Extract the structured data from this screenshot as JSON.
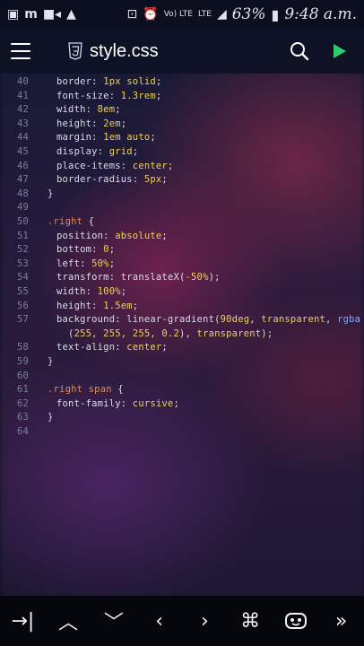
{
  "status_bar": {
    "icons_left": [
      "photos-icon",
      "m-app-icon",
      "video-icon",
      "warning-icon"
    ],
    "icons_right": [
      "cast-icon",
      "alarm-icon",
      "volte-icon",
      "lte-icon",
      "signal-icon"
    ],
    "volte_label": "Vo) LTE",
    "lte_label": "LTE",
    "battery_percent": "63%",
    "time": "9:48 a.m."
  },
  "toolbar": {
    "file_name": "style.css",
    "menu_icon": "hamburger-icon",
    "file_type_icon": "css3-icon",
    "search_icon": "search-icon",
    "run_icon": "play-icon",
    "accent_color": "#2ecc71"
  },
  "editor": {
    "lines": [
      {
        "n": "40",
        "parts": [
          [
            "prop",
            "border: "
          ],
          [
            "val",
            "1px solid"
          ],
          [
            "prop",
            ";"
          ]
        ]
      },
      {
        "n": "41",
        "parts": [
          [
            "prop",
            "font-size: "
          ],
          [
            "val",
            "1.3rem"
          ],
          [
            "prop",
            ";"
          ]
        ]
      },
      {
        "n": "42",
        "parts": [
          [
            "prop",
            "width: "
          ],
          [
            "val",
            "8em"
          ],
          [
            "prop",
            ";"
          ]
        ]
      },
      {
        "n": "43",
        "parts": [
          [
            "prop",
            "height: "
          ],
          [
            "val",
            "2em"
          ],
          [
            "prop",
            ";"
          ]
        ]
      },
      {
        "n": "44",
        "parts": [
          [
            "prop",
            "margin: "
          ],
          [
            "val",
            "1em auto"
          ],
          [
            "prop",
            ";"
          ]
        ]
      },
      {
        "n": "45",
        "parts": [
          [
            "prop",
            "display: "
          ],
          [
            "val",
            "grid"
          ],
          [
            "prop",
            ";"
          ]
        ]
      },
      {
        "n": "46",
        "parts": [
          [
            "prop",
            "place-items: "
          ],
          [
            "val",
            "center"
          ],
          [
            "prop",
            ";"
          ]
        ]
      },
      {
        "n": "47",
        "parts": [
          [
            "prop",
            "border-radius: "
          ],
          [
            "val",
            "5px"
          ],
          [
            "prop",
            ";"
          ]
        ]
      },
      {
        "n": "48",
        "parts": [
          [
            "brace",
            "}"
          ]
        ],
        "indent": 0
      },
      {
        "n": "49",
        "parts": []
      },
      {
        "n": "50",
        "parts": [
          [
            "sel",
            ".right "
          ],
          [
            "brace",
            "{"
          ]
        ],
        "indent": 0
      },
      {
        "n": "51",
        "parts": [
          [
            "prop",
            "position: "
          ],
          [
            "val",
            "absolute"
          ],
          [
            "prop",
            ";"
          ]
        ]
      },
      {
        "n": "52",
        "parts": [
          [
            "prop",
            "bottom: "
          ],
          [
            "val",
            "0"
          ],
          [
            "prop",
            ";"
          ]
        ]
      },
      {
        "n": "53",
        "parts": [
          [
            "prop",
            "left: "
          ],
          [
            "val",
            "50%"
          ],
          [
            "prop",
            ";"
          ]
        ]
      },
      {
        "n": "54",
        "parts": [
          [
            "prop",
            "transform: "
          ],
          [
            "fn",
            "translateX("
          ],
          [
            "val",
            "-50%"
          ],
          [
            "fn",
            ")"
          ],
          [
            "prop",
            ";"
          ]
        ]
      },
      {
        "n": "55",
        "parts": [
          [
            "prop",
            "width: "
          ],
          [
            "val",
            "100%"
          ],
          [
            "prop",
            ";"
          ]
        ]
      },
      {
        "n": "56",
        "parts": [
          [
            "prop",
            "height: "
          ],
          [
            "val",
            "1.5em"
          ],
          [
            "prop",
            ";"
          ]
        ]
      },
      {
        "n": "57",
        "parts": [
          [
            "prop",
            "background: "
          ],
          [
            "fn",
            "linear-gradient("
          ],
          [
            "val",
            "90deg"
          ],
          [
            "fn",
            ", "
          ],
          [
            "val",
            "transparent"
          ],
          [
            "fn",
            ", "
          ],
          [
            "ident",
            "rgba"
          ]
        ]
      },
      {
        "n": "",
        "parts": [
          [
            "fn",
            "  ("
          ],
          [
            "val",
            "255, 255, 255, 0.2"
          ],
          [
            "fn",
            "), "
          ],
          [
            "val",
            "transparent"
          ],
          [
            "fn",
            ")"
          ],
          [
            "prop",
            ";"
          ]
        ]
      },
      {
        "n": "58",
        "parts": [
          [
            "prop",
            "text-align: "
          ],
          [
            "val",
            "center"
          ],
          [
            "prop",
            ";"
          ]
        ]
      },
      {
        "n": "59",
        "parts": [
          [
            "brace",
            "}"
          ]
        ],
        "indent": 0
      },
      {
        "n": "60",
        "parts": []
      },
      {
        "n": "61",
        "parts": [
          [
            "sel",
            ".right span "
          ],
          [
            "brace",
            "{"
          ]
        ],
        "indent": 0
      },
      {
        "n": "62",
        "parts": [
          [
            "prop",
            "font-family: "
          ],
          [
            "val",
            "cursive"
          ],
          [
            "prop",
            ";"
          ]
        ]
      },
      {
        "n": "63",
        "parts": [
          [
            "brace",
            "}"
          ]
        ],
        "indent": 0
      },
      {
        "n": "64",
        "parts": []
      }
    ]
  },
  "keybar": {
    "keys": [
      {
        "label": "→|",
        "icon": "tab-icon"
      },
      {
        "label": "︿",
        "icon": "arrow-up-icon"
      },
      {
        "label": "﹀",
        "icon": "arrow-down-icon"
      },
      {
        "label": "‹",
        "icon": "arrow-left-icon"
      },
      {
        "label": "›",
        "icon": "arrow-right-icon"
      },
      {
        "label": "⌘",
        "icon": "command-icon"
      },
      {
        "label": "",
        "icon": "robot-icon"
      },
      {
        "label": "»",
        "icon": "more-icon"
      }
    ]
  }
}
